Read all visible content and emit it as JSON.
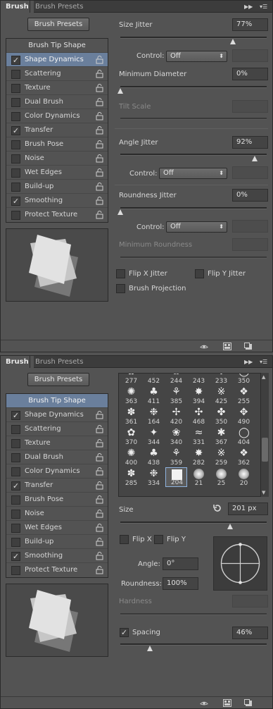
{
  "panel_top": {
    "tabs": {
      "brush": "Brush",
      "presets": "Brush Presets"
    },
    "presets_button": "Brush Presets",
    "list": {
      "header": "Brush Tip Shape",
      "items": [
        {
          "label": "Shape Dynamics",
          "checked": "✓"
        },
        {
          "label": "Scattering",
          "checked": ""
        },
        {
          "label": "Texture",
          "checked": ""
        },
        {
          "label": "Dual Brush",
          "checked": ""
        },
        {
          "label": "Color Dynamics",
          "checked": ""
        },
        {
          "label": "Transfer",
          "checked": "✓"
        },
        {
          "label": "Brush Pose",
          "checked": ""
        },
        {
          "label": "Noise",
          "checked": ""
        },
        {
          "label": "Wet Edges",
          "checked": ""
        },
        {
          "label": "Build-up",
          "checked": ""
        },
        {
          "label": "Smoothing",
          "checked": "✓"
        },
        {
          "label": "Protect Texture",
          "checked": ""
        }
      ]
    },
    "size_jitter": {
      "label": "Size Jitter",
      "value": "77%",
      "level": 0.77
    },
    "control1": {
      "label": "Control:",
      "value": "Off"
    },
    "min_diameter": {
      "label": "Minimum Diameter",
      "value": "0%",
      "level": 0.0
    },
    "tilt_scale": {
      "label": "Tilt Scale"
    },
    "angle_jitter": {
      "label": "Angle Jitter",
      "value": "92%",
      "level": 0.92
    },
    "control2": {
      "label": "Control:",
      "value": "Off"
    },
    "roundness_jitter": {
      "label": "Roundness Jitter",
      "value": "0%",
      "level": 0.0
    },
    "control3": {
      "label": "Control:",
      "value": "Off"
    },
    "min_roundness": {
      "label": "Minimum Roundness"
    },
    "flip_x": "Flip X Jitter",
    "flip_y": "Flip Y Jitter",
    "brush_projection": "Brush Projection"
  },
  "panel_bottom": {
    "tabs": {
      "brush": "Brush",
      "presets": "Brush Presets"
    },
    "presets_button": "Brush Presets",
    "tip_grid": [
      [
        "277",
        "452",
        "244",
        "243",
        "233",
        "350"
      ],
      [
        "363",
        "411",
        "385",
        "394",
        "425",
        "255"
      ],
      [
        "361",
        "164",
        "420",
        "468",
        "350",
        "490"
      ],
      [
        "370",
        "344",
        "340",
        "331",
        "367",
        "404"
      ],
      [
        "400",
        "438",
        "359",
        "282",
        "259",
        "362"
      ],
      [
        "285",
        "334",
        "204",
        "21",
        "25",
        "20"
      ]
    ],
    "size": {
      "label": "Size",
      "value": "201 px",
      "level": 0.75
    },
    "flip_x": "Flip X",
    "flip_y": "Flip Y",
    "angle": {
      "label": "Angle:",
      "value": "0°"
    },
    "roundness": {
      "label": "Roundness:",
      "value": "100%"
    },
    "hardness": {
      "label": "Hardness"
    },
    "spacing": {
      "label": "Spacing",
      "value": "46%",
      "level": 0.2
    }
  }
}
